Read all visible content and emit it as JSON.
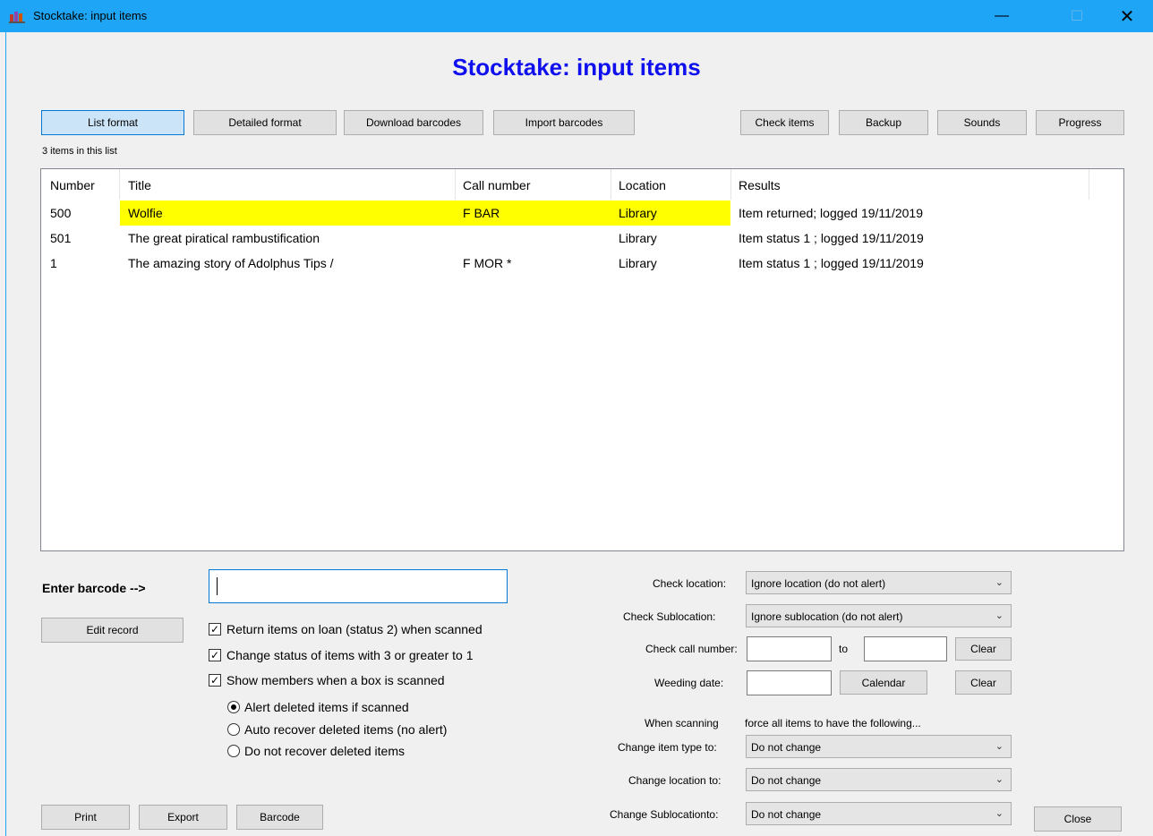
{
  "window": {
    "title": "Stocktake: input items",
    "minimize_glyph": "—",
    "maximize_glyph": "☐",
    "close_glyph": "✕"
  },
  "heading": "Stocktake: input items",
  "toolbar": {
    "list_format": "List format",
    "detailed_format": "Detailed format",
    "download_barcodes": "Download barcodes",
    "import_barcodes": "Import barcodes",
    "check_items": "Check items",
    "backup": "Backup",
    "sounds": "Sounds",
    "progress": "Progress"
  },
  "item_count": "3 items in this list",
  "list": {
    "columns": [
      "Number",
      "Title",
      "Call number",
      "Location",
      "Results"
    ],
    "rows": [
      {
        "number": "500",
        "title": "Wolfie",
        "call": "F BAR",
        "location": "Library",
        "results": "Item returned; logged 19/11/2019",
        "highlight": true
      },
      {
        "number": "501",
        "title": "The great piratical rambustification",
        "call": "",
        "location": "Library",
        "results": "Item status 1 ; logged 19/11/2019",
        "highlight": false
      },
      {
        "number": "1",
        "title": "The amazing story of Adolphus Tips /",
        "call": "F MOR *",
        "location": "Library",
        "results": "Item status 1 ; logged 19/11/2019",
        "highlight": false
      }
    ],
    "highlight_color": "#ffff00"
  },
  "barcode": {
    "label": "Enter barcode -->",
    "value": ""
  },
  "edit_record": "Edit record",
  "options": {
    "return_on_loan": {
      "label": "Return items on loan (status 2) when scanned",
      "checked": true
    },
    "change_status": {
      "label": "Change status of items with 3 or greater to 1",
      "checked": true
    },
    "show_members": {
      "label": "Show members when a box is scanned",
      "checked": true
    }
  },
  "deleted_mode": {
    "alert": "Alert deleted items if scanned",
    "auto_recover": "Auto recover deleted items (no alert)",
    "no_recover": "Do not recover deleted items",
    "selected": "alert"
  },
  "checks": {
    "location_label": "Check location:",
    "location_value": "Ignore location (do not alert)",
    "sublocation_label": "Check Sublocation:",
    "sublocation_value": "Ignore sublocation (do not alert)",
    "callnum_label": "Check call number:",
    "callnum_from": "",
    "callnum_to_label": "to",
    "callnum_to": "",
    "clear": "Clear",
    "weeding_label": "Weeding date:",
    "weeding_value": "",
    "calendar": "Calendar"
  },
  "force": {
    "note_left": "When scanning",
    "note_right": "force all items to have the following...",
    "item_type_label": "Change item type to:",
    "item_type_value": "Do not change",
    "location_label": "Change location to:",
    "location_value": "Do not change",
    "sublocation_label": "Change Sublocationto:",
    "sublocation_value": "Do not change"
  },
  "bottom": {
    "print": "Print",
    "export": "Export",
    "barcode": "Barcode",
    "close": "Close"
  },
  "icons": {
    "dropdown": "chevron-down-icon",
    "app": "stocktake-app-icon",
    "check": "checkmark-icon"
  }
}
